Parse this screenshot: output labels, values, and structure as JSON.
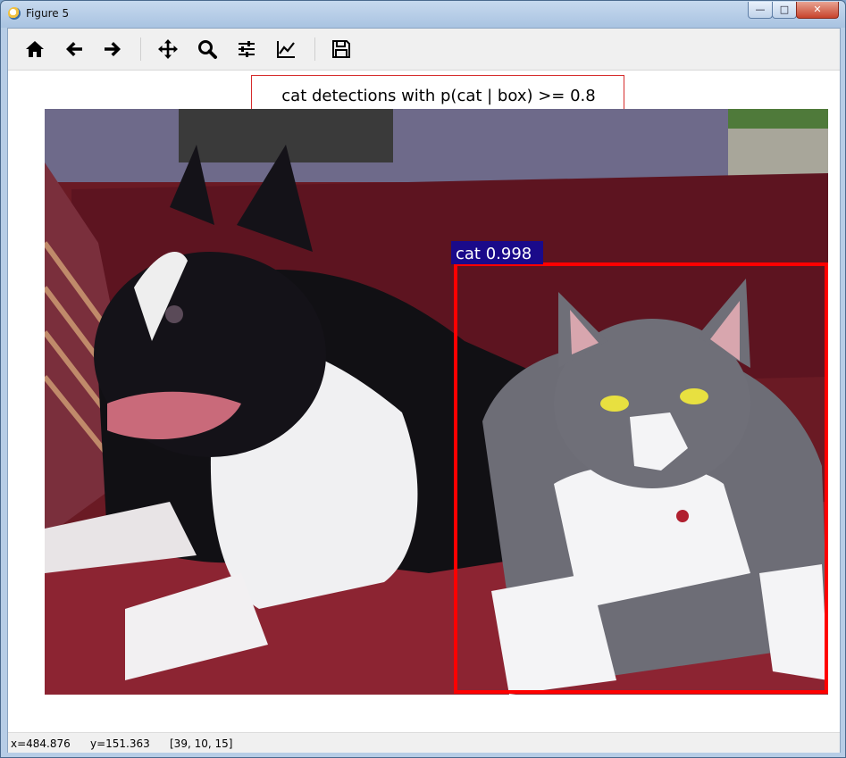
{
  "window": {
    "title": "Figure 5",
    "minimize_label": "—",
    "maximize_label": "□",
    "close_label": "✕"
  },
  "toolbar": {
    "buttons": [
      {
        "name": "home",
        "icon": "home-icon"
      },
      {
        "name": "back",
        "icon": "arrow-left-icon"
      },
      {
        "name": "forward",
        "icon": "arrow-right-icon"
      },
      {
        "name": "pan",
        "icon": "move-icon"
      },
      {
        "name": "zoom",
        "icon": "magnifier-icon"
      },
      {
        "name": "configure-subplots",
        "icon": "sliders-icon"
      },
      {
        "name": "edit-axes",
        "icon": "line-chart-icon"
      },
      {
        "name": "save",
        "icon": "floppy-disk-icon"
      }
    ]
  },
  "plot": {
    "title": "cat detections with p(cat | box) >= 0.8",
    "detection_label": "cat 0.998"
  },
  "status": {
    "x": "x=484.876",
    "y": "y=151.363",
    "pixel": "[39, 10, 15]"
  },
  "colors": {
    "box_edge": "#ff0000",
    "label_bg": "#1a0a8a",
    "title_box_edge": "#d62c2c"
  }
}
